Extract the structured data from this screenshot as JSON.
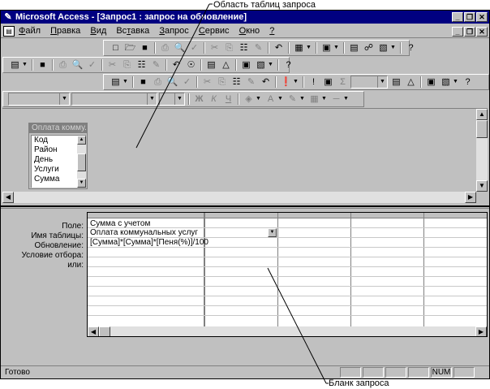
{
  "window": {
    "title": "Microsoft Access - [Запрос1 : запрос на обновление]",
    "app_icon": "key-icon"
  },
  "menu": {
    "items": [
      {
        "label": "Файл",
        "accel": "Ф",
        "rest": "айл"
      },
      {
        "label": "Правка",
        "accel": "П",
        "rest": "равка"
      },
      {
        "label": "Вид",
        "accel": "В",
        "rest": "ид"
      },
      {
        "label": "Вставка",
        "accel": "т",
        "pre": "Вс",
        "rest": "авка"
      },
      {
        "label": "Запрос",
        "accel": "З",
        "rest": "апрос"
      },
      {
        "label": "Сервис",
        "accel": "С",
        "rest": "ервис"
      },
      {
        "label": "Окно",
        "accel": "О",
        "rest": "кно"
      },
      {
        "label": "?",
        "accel": "?",
        "rest": ""
      }
    ]
  },
  "table_list": {
    "title": "Оплата комму...",
    "fields": [
      "Код",
      "Район",
      "День",
      "Услуги",
      "Сумма"
    ]
  },
  "design_grid": {
    "row_labels": [
      "Поле:",
      "Имя таблицы:",
      "Обновление:",
      "Условие отбора:",
      "или:"
    ],
    "column1": {
      "field": "Сумма с учетом",
      "table": "Оплата коммунальных услуг",
      "update_to": "[Сумма]*[Сумма]*[Пеня(%)]/100"
    }
  },
  "status": {
    "text": "Готово",
    "num": "NUM"
  },
  "callouts": {
    "upper": "Область таблиц запроса",
    "lower": "Бланк запроса"
  }
}
